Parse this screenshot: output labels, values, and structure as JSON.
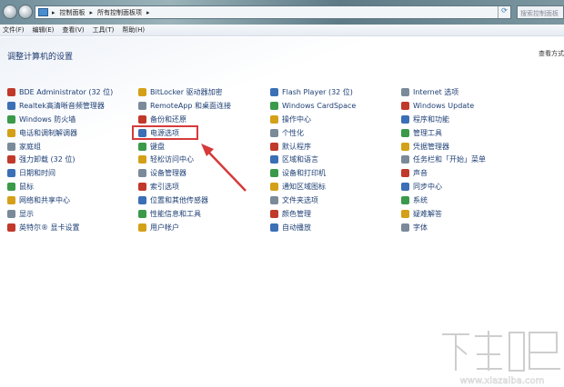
{
  "address": {
    "crumbs": [
      "控制面板",
      "所有控制面板项"
    ],
    "search_placeholder": "搜索控制面板"
  },
  "menu": [
    "文件(F)",
    "编辑(E)",
    "查看(V)",
    "工具(T)",
    "帮助(H)"
  ],
  "title": "调整计算机的设置",
  "view_by": "查看方式",
  "columns": [
    [
      "BDE Administrator (32 位)",
      "Realtek高清晰音频管理器",
      "Windows 防火墙",
      "电话和调制解调器",
      "家庭组",
      "强力卸载 (32 位)",
      "日期和时间",
      "鼠标",
      "网络和共享中心",
      "显示",
      "英特尔® 显卡设置"
    ],
    [
      "BitLocker 驱动器加密",
      "RemoteApp 和桌面连接",
      "备份和还原",
      "电源选项",
      "键盘",
      "轻松访问中心",
      "设备管理器",
      "索引选项",
      "位置和其他传感器",
      "性能信息和工具",
      "用户帐户"
    ],
    [
      "Flash Player (32 位)",
      "Windows CardSpace",
      "操作中心",
      "个性化",
      "默认程序",
      "区域和语言",
      "设备和打印机",
      "通知区域图标",
      "文件夹选项",
      "颜色管理",
      "自动播放"
    ],
    [
      "Internet 选项",
      "Windows Update",
      "程序和功能",
      "管理工具",
      "凭据管理器",
      "任务栏和「开始」菜单",
      "声音",
      "同步中心",
      "系统",
      "疑难解答",
      "字体"
    ]
  ],
  "icon_colors": [
    "#c0392b",
    "#3b6fb6",
    "#3a9a4a",
    "#d4a017",
    "#7a8a99"
  ],
  "highlight_color": "#d63a3a",
  "watermark": {
    "text": "下载吧",
    "url": "www.xiazaiba.com"
  }
}
